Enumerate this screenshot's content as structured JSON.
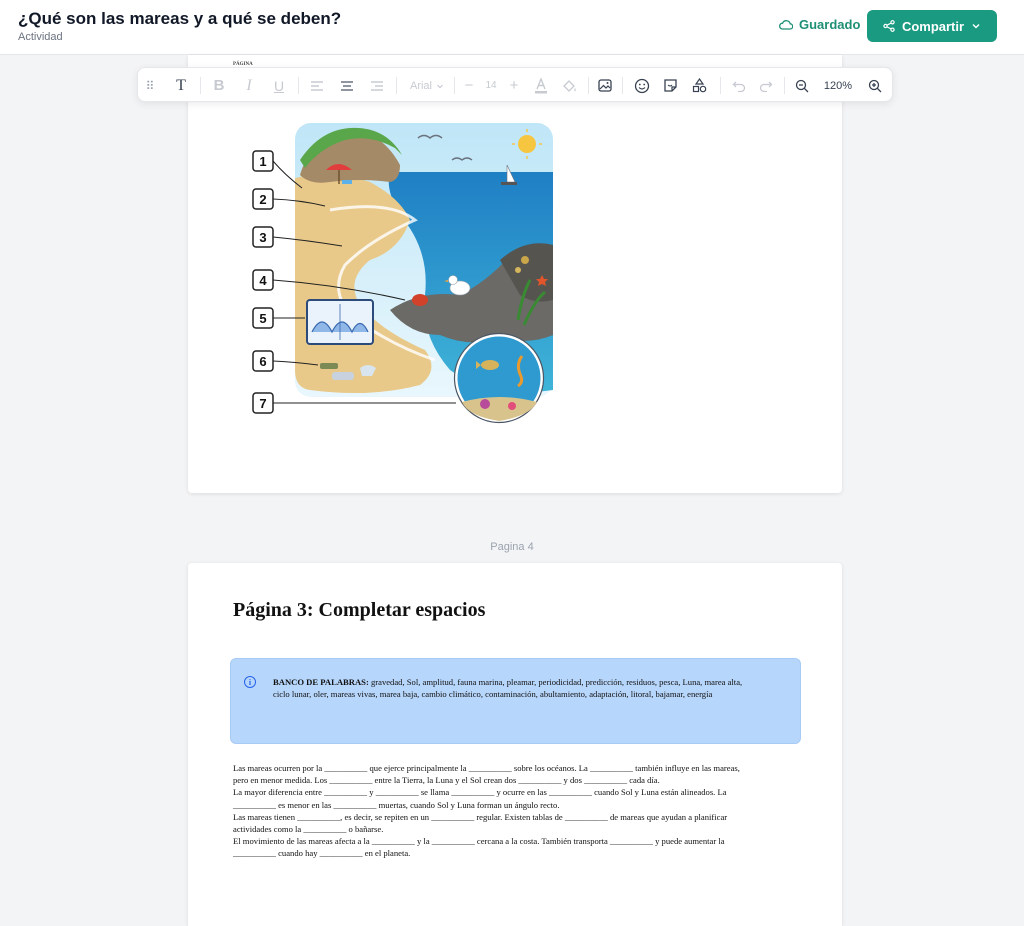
{
  "header": {
    "title": "¿Qué son las mareas y a qué se deben?",
    "subtitle": "Actividad",
    "saved_label": "Guardado",
    "share_label": "Compartir"
  },
  "toolbar": {
    "font_name": "Arial",
    "font_size": "14",
    "zoom": "120%"
  },
  "page_peek_text": "PÁGINA",
  "illustration": {
    "labels": [
      "1",
      "2",
      "3",
      "4",
      "5",
      "6",
      "7"
    ]
  },
  "page_label": "Pagina 4",
  "page3": {
    "title": "Página 3: Completar espacios",
    "bank_label": "BANCO DE PALABRAS:",
    "bank_line1": "gravedad, Sol, amplitud, fauna marina, pleamar, periodicidad, predicción, residuos, pesca, Luna, marea alta,",
    "bank_line2": "ciclo lunar, oler, mareas vivas, marea baja, cambio climático, contaminación, abultamiento, adaptación, litoral, bajamar, energía",
    "lines": [
      "Las mareas ocurren por la __________ que ejerce principalmente la __________ sobre los océanos. La __________ también influye en las mareas,",
      "pero en menor medida. Los __________ entre la Tierra, la Luna y el Sol crean dos __________ y dos __________ cada día.",
      "La mayor diferencia entre __________ y __________ se llama __________ y ocurre en las __________ cuando Sol y Luna están alineados. La",
      "__________ es menor en las __________ muertas, cuando Sol y Luna forman un ángulo recto.",
      "Las mareas tienen __________, es decir, se repiten en un __________ regular. Existen tablas de __________ de mareas que ayudan a planificar",
      "actividades como la __________ o bañarse.",
      "El movimiento de las mareas afecta a la __________ y la __________ cercana a la costa. También transporta __________ y puede aumentar la",
      "__________ cuando hay __________ en el planeta."
    ]
  }
}
